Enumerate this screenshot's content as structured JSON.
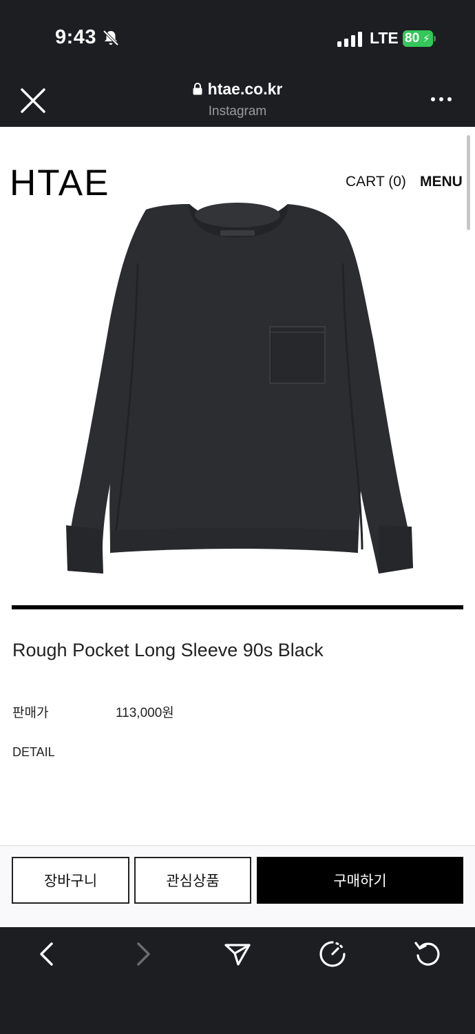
{
  "status_bar": {
    "time": "9:43",
    "network": "LTE",
    "battery": "80",
    "icons": [
      "bell-slash-icon",
      "signal-icon",
      "battery-charging-icon"
    ]
  },
  "browser_header": {
    "domain": "htae.co.kr",
    "source": "Instagram",
    "icons": [
      "close-icon",
      "lock-icon",
      "more-icon"
    ]
  },
  "site": {
    "logo": "HTAE",
    "cart": "CART (0)",
    "menu": "MENU"
  },
  "product": {
    "name": "Rough Pocket Long Sleeve 90s Black",
    "price_label": "판매가",
    "price": "113,000원",
    "detail_label": "DETAIL",
    "image": "black-long-sleeve-pocket-tshirt"
  },
  "actions": {
    "cart_button": "장바구니",
    "wishlist_button": "관심상품",
    "buy_button": "구매하기"
  },
  "toolbar": {
    "icons": [
      "back-icon",
      "forward-icon",
      "share-icon",
      "speed-icon",
      "reload-icon"
    ]
  },
  "colors": {
    "chrome_bg": "#1c1e22",
    "battery_green": "#34c759",
    "buy_button_bg": "#000000",
    "page_bg": "#ffffff"
  }
}
